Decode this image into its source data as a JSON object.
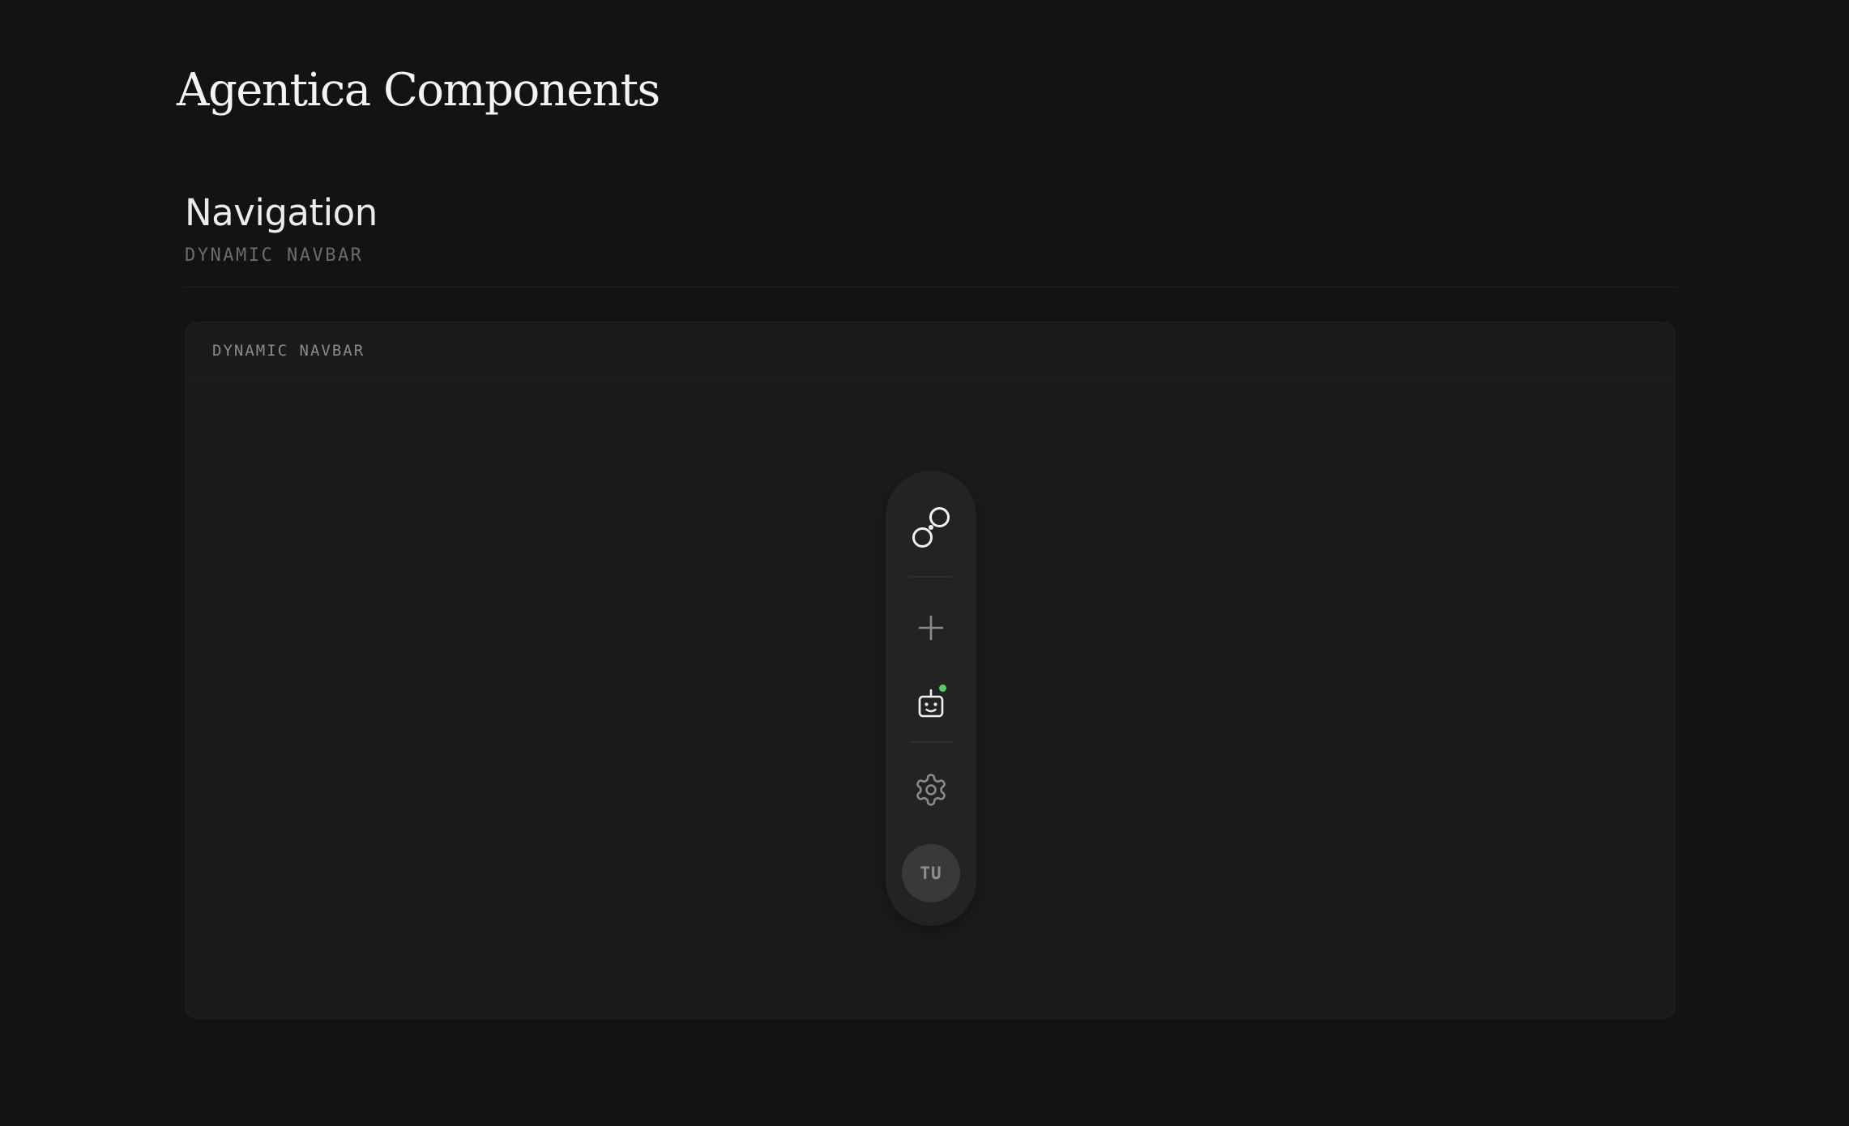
{
  "page": {
    "title": "Agentica Components"
  },
  "section": {
    "title": "Navigation",
    "subtitle": "DYNAMIC NAVBAR"
  },
  "demo": {
    "label": "DYNAMIC NAVBAR"
  },
  "navbar": {
    "items": [
      {
        "icon": "link-logo-icon"
      },
      {
        "icon": "plus-icon"
      },
      {
        "icon": "robot-icon",
        "status": "online"
      },
      {
        "icon": "gear-icon"
      }
    ],
    "avatar": {
      "initials": "TU"
    }
  },
  "colors": {
    "page_background": "#131313",
    "card_background": "#1b1b1b",
    "navbar_background": "#232323",
    "status_online": "#4cd06a",
    "avatar_background": "#393939"
  }
}
